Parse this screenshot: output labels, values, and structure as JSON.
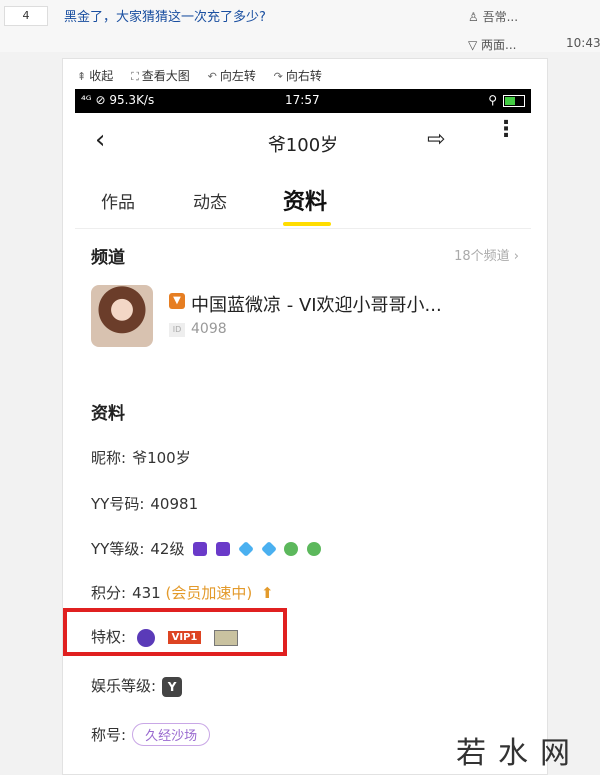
{
  "forum": {
    "floor": "4",
    "title": "黑金了，大家猜猜这一次充了多少?",
    "author": "♙ 吾常...",
    "reply": "▽ 两面...",
    "time": "10:43"
  },
  "viewer_toolbar": [
    {
      "icon": "⇞",
      "label": "收起"
    },
    {
      "icon": "⛶",
      "label": "查看大图"
    },
    {
      "icon": "↶",
      "label": "向左转"
    },
    {
      "icon": "↷",
      "label": "向右转"
    }
  ],
  "statusbar": {
    "left": "⁴ᴳ ⊘ 95.3K/s",
    "time": "17:57",
    "right": "⚲"
  },
  "app_header": {
    "title": "爷100岁",
    "back_icon": "‹",
    "share_icon": "⇨",
    "more_icon": "⋮"
  },
  "tabs": [
    {
      "label": "作品"
    },
    {
      "label": "动态"
    },
    {
      "label": "资料"
    }
  ],
  "channel": {
    "section_title": "频道",
    "count": "18个频道 ›",
    "name": "中国蓝微凉 - VI欢迎小哥哥小...",
    "badge": "▼",
    "id_icon": "ID",
    "id": "4098"
  },
  "profile": {
    "section_title": "资料",
    "nickname_label": "昵称:",
    "nickname": "爷100岁",
    "yyid_label": "YY号码:",
    "yyid": "40981",
    "level_label": "YY等级:",
    "level": "42级",
    "points_label": "积分:",
    "points": "431",
    "points_note": "(会员加速中)",
    "privilege_label": "特权:",
    "vip": "VIP1",
    "ent_level_label": "娱乐等级:",
    "ent_badge": "Y",
    "title_label": "称号:",
    "title_value": "久经沙场"
  },
  "watermark": "若水网"
}
